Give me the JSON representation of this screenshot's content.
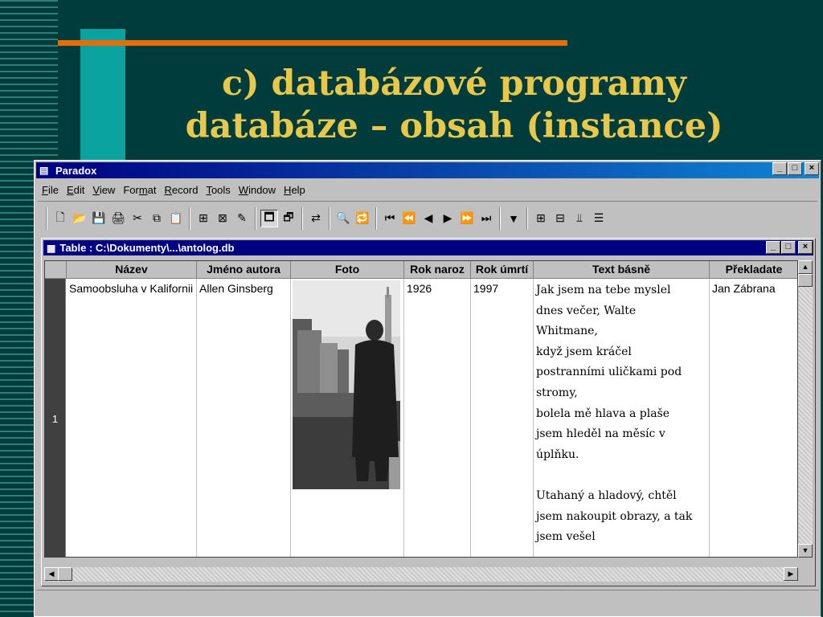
{
  "slide": {
    "title_line1": "c) databázové programy",
    "title_line2": "databáze – obsah (instance)"
  },
  "app": {
    "title": "Paradox",
    "minimize": "_",
    "maximize": "□",
    "close": "×"
  },
  "menu": {
    "file": {
      "u": "F",
      "rest": "ile"
    },
    "edit": {
      "u": "E",
      "rest": "dit"
    },
    "view": {
      "u": "V",
      "rest": "iew"
    },
    "format": {
      "pre": "For",
      "u": "m",
      "rest": "at"
    },
    "record": {
      "u": "R",
      "rest": "ecord"
    },
    "tools": {
      "u": "T",
      "rest": "ools"
    },
    "window": {
      "u": "W",
      "rest": "indow"
    },
    "help": {
      "u": "H",
      "rest": "elp"
    }
  },
  "toolbar_icons": {
    "new": "🗋",
    "open": "📂",
    "save": "💾",
    "print": "🖨",
    "cut": "✂",
    "copy": "⧉",
    "paste": "📋",
    "design": "⊞",
    "query": "⊠",
    "expert": "✎",
    "view_data": "🗖",
    "edit_data": "🗗",
    "field_view": "⇄",
    "find": "🔍",
    "replace": "🔁",
    "first": "⏮",
    "prev_set": "⏪",
    "prev": "◀",
    "next": "▶",
    "next_set": "⏩",
    "last": "⏭",
    "filter": "▼",
    "new_table": "⊞",
    "new_form": "⊟",
    "new_chart": "⫫",
    "new_report": "☰"
  },
  "table_window": {
    "title": "Table : C:\\Dokumenty\\...\\antolog.db",
    "columns": [
      "Název",
      "Jméno autora",
      "Foto",
      "Rok naroz",
      "Rok úmrtí",
      "Text básně",
      "Překladate"
    ],
    "row": {
      "number": "1",
      "nazev": "Samoobsluha v Kalifornii",
      "autor": "Allen Ginsberg",
      "rok_narozeni": "1926",
      "rok_umrti": "1997",
      "text_lines": [
        "Jak jsem na tebe myslel",
        "dnes večer, Walte",
        "Whitmane,",
        "když jsem kráčel",
        "postranními uličkami pod",
        "stromy,",
        "bolela mě hlava a plaše",
        "jsem hleděl na měsíc v",
        "úplňku.",
        "",
        "Utahaný a hladový, chtěl",
        "jsem nakoupit obrazy, a tak",
        "jsem vešel"
      ],
      "prekladatel": "Jan Zábrana"
    }
  }
}
